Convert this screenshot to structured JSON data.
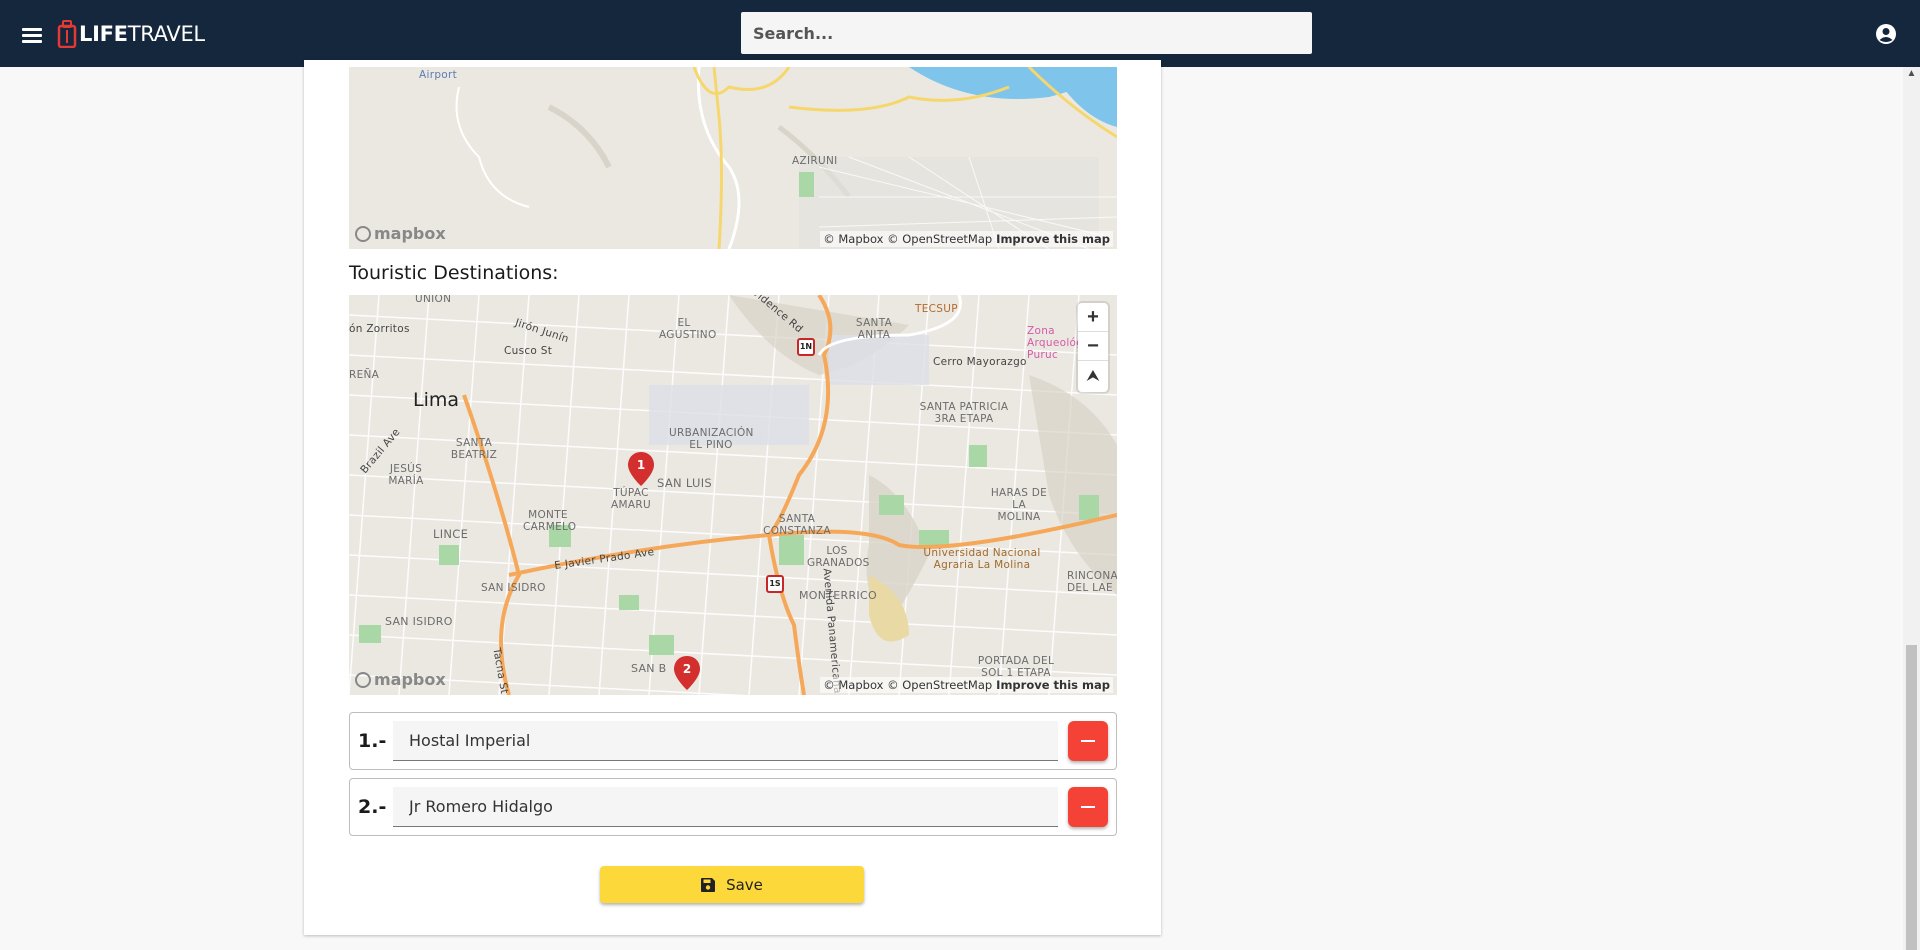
{
  "app": {
    "brand_bold": "LIFE",
    "brand_light": "TRAVEL"
  },
  "search": {
    "placeholder": "Search..."
  },
  "map1": {
    "labels": {
      "airport": "Airport",
      "aziruni": "AZIRUNI"
    },
    "attribution": "© Mapbox © OpenStreetMap",
    "improve": "Improve this map",
    "logo": "mapbox"
  },
  "section": {
    "title": "Touristic Destinations:"
  },
  "map2": {
    "labels": {
      "lima": "Lima",
      "agustino": "EL AGUSTINO",
      "santa_anita": "SANTA ANITA",
      "tecsup": "TECSUP",
      "cerro": "Cerro Mayorazgo",
      "patricia": "SANTA PATRICIA 3RA ETAPA",
      "urbanizacion": "URBANIZACIÓN EL PINO",
      "san_luis": "SAN LUIS",
      "tupac": "TÚPAC AMARU",
      "santa_beatriz": "SANTA BEATRIZ",
      "jesus_maria": "JESÚS MARÍA",
      "lince": "LINCE",
      "monte_carmelo": "MONTE CARMELO",
      "santa_constanza": "SANTA CONSTANZA",
      "los_granados": "LOS GRANADOS",
      "monterrico": "MONTERRICO",
      "san_isidro_upper": "SAN ISIDRO",
      "san_isidro": "SAN ISIDRO",
      "haras": "HARAS DE LA MOLINA",
      "univ": "Universidad Nacional Agraria La Molina",
      "rincon": "RINCONA DEL LAE",
      "portada": "PORTADA DEL SOL 1 ETAPA",
      "javier": "E Javier Prado Ave",
      "brazil": "Brazil Ave",
      "jiron": "Jirón Junín",
      "cusco": "Cusco St",
      "zorritos": "ón Zorritos",
      "union": "UNIÓN",
      "brena": "REÑA",
      "avenida": "Avenida Panamericana",
      "tacna": "Tacna St",
      "evidence": "vidence Rd",
      "zona": "Zona Arqueológica Puruc",
      "san_b": "SAN B",
      "route_1n": "1N",
      "route_1s": "1S"
    },
    "markers": [
      "1",
      "2"
    ],
    "zoom_in": "+",
    "zoom_out": "−",
    "compass": "⮝",
    "attribution": "© Mapbox © OpenStreetMap",
    "improve": "Improve this map",
    "logo": "mapbox"
  },
  "destinations": [
    {
      "number": "1.-",
      "value": "Hostal Imperial"
    },
    {
      "number": "2.-",
      "value": "Jr Romero Hidalgo"
    }
  ],
  "save": {
    "label": "Save"
  },
  "icons": {
    "menu": "menu-icon",
    "account": "account-circle-icon",
    "save": "floppy-disk-icon",
    "remove": "minus-icon"
  },
  "colors": {
    "topbar": "#14273d",
    "save_button": "#fdd83b",
    "remove_button": "#f44336",
    "marker": "#d32f2f",
    "brand_red": "#e53935"
  }
}
